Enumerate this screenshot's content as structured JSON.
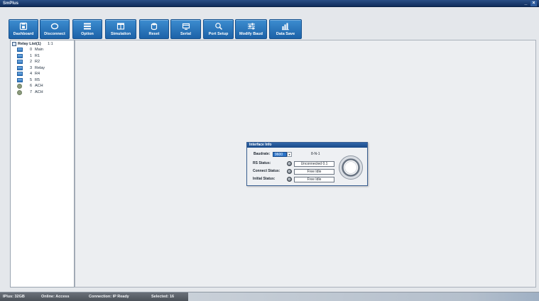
{
  "window": {
    "title": "SmPlus",
    "minimize_label": "_",
    "close_label": "×"
  },
  "toolbar": [
    {
      "label": "Dashboard",
      "icon": "dashboard-icon"
    },
    {
      "label": "Disconnect",
      "icon": "connect-icon"
    },
    {
      "label": "Option",
      "icon": "list-icon"
    },
    {
      "label": "Simulation",
      "icon": "window-icon"
    },
    {
      "label": "Reset",
      "icon": "database-icon"
    },
    {
      "label": "Serial",
      "icon": "monitor-icon"
    },
    {
      "label": "Port Setup",
      "icon": "search-icon"
    },
    {
      "label": "Modify Baud",
      "icon": "sliders-icon"
    },
    {
      "label": "Data Save",
      "icon": "bar-chart-icon"
    }
  ],
  "tree": {
    "root": {
      "label": "Relay List(1)",
      "count": "1:1",
      "icon": "folder-icon"
    },
    "items": [
      {
        "num": "0",
        "label": "Main",
        "icon": "device-icon"
      },
      {
        "num": "1",
        "label": "R1",
        "icon": "device-icon"
      },
      {
        "num": "2",
        "label": "R2",
        "icon": "device-icon"
      },
      {
        "num": "3",
        "label": "Relay",
        "icon": "device-icon"
      },
      {
        "num": "4",
        "label": "R4",
        "icon": "device-icon"
      },
      {
        "num": "5",
        "label": "R5",
        "icon": "device-icon"
      },
      {
        "num": "6",
        "label": "ACH",
        "icon": "gear-icon"
      },
      {
        "num": "7",
        "label": "ACH",
        "icon": "gear-icon"
      }
    ]
  },
  "dialog": {
    "title": "Interface Info",
    "baudrate_label": "Baudrate:",
    "baudrate_value": "9600",
    "dropdown_arrow": "▾",
    "frame_format": "8-N-1",
    "rows": [
      {
        "label": "RS Status:",
        "value": "Unconnected 0.1",
        "icon": "status-led-icon"
      },
      {
        "label": "Connect Status:",
        "value": "Free Idle",
        "icon": "status-led-icon"
      },
      {
        "label": "Initial Status:",
        "value": "Free Idle",
        "icon": "status-led-icon"
      }
    ],
    "gauge_icon": "gauge-icon"
  },
  "statusbar": [
    {
      "text": "IPlus: 32GB"
    },
    {
      "text": "Online: Access"
    },
    {
      "text": "Connection: IP Ready"
    },
    {
      "text": "Selected: 16"
    }
  ],
  "colors": {
    "titlebar": "#0f2d5c",
    "toolbar_button": "#2a74bb",
    "dialog_title": "#1f4f8c",
    "background": "#e4e7eb"
  }
}
